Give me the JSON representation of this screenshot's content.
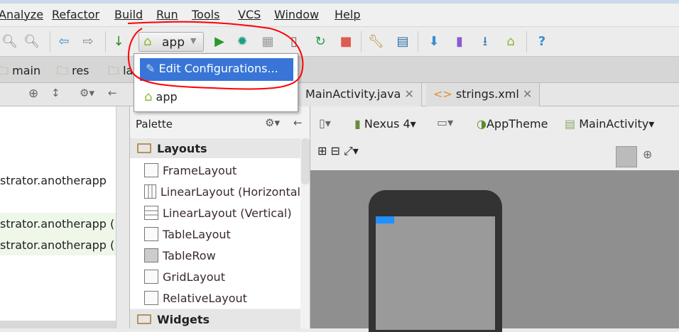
{
  "menu": [
    "Analyze",
    "Refactor",
    "Build",
    "Run",
    "Tools",
    "VCS",
    "Window",
    "Help"
  ],
  "toolbar": {
    "run_config": "app"
  },
  "breadcrumb": [
    "main",
    "res",
    "la"
  ],
  "popup": {
    "items": [
      "Edit Configurations...",
      "app"
    ]
  },
  "tabs": [
    "MainActivity.java",
    "strings.xml"
  ],
  "left_panel": {
    "lines": [
      "strator.anotherapp",
      "strator.anotherapp (",
      "strator.anotherapp ("
    ]
  },
  "palette": {
    "title": "Palette",
    "categories": [
      "Layouts",
      "Widgets"
    ],
    "items": [
      "FrameLayout",
      "LinearLayout (Horizontal",
      "LinearLayout (Vertical)",
      "TableLayout",
      "TableRow",
      "GridLayout",
      "RelativeLayout"
    ]
  },
  "designer": {
    "device": "Nexus 4",
    "theme": "AppTheme",
    "activity": "MainActivity"
  },
  "colors": {
    "selection": "#3875d7",
    "annotation": "#ff0000",
    "canvas": "#8f8f8f"
  }
}
